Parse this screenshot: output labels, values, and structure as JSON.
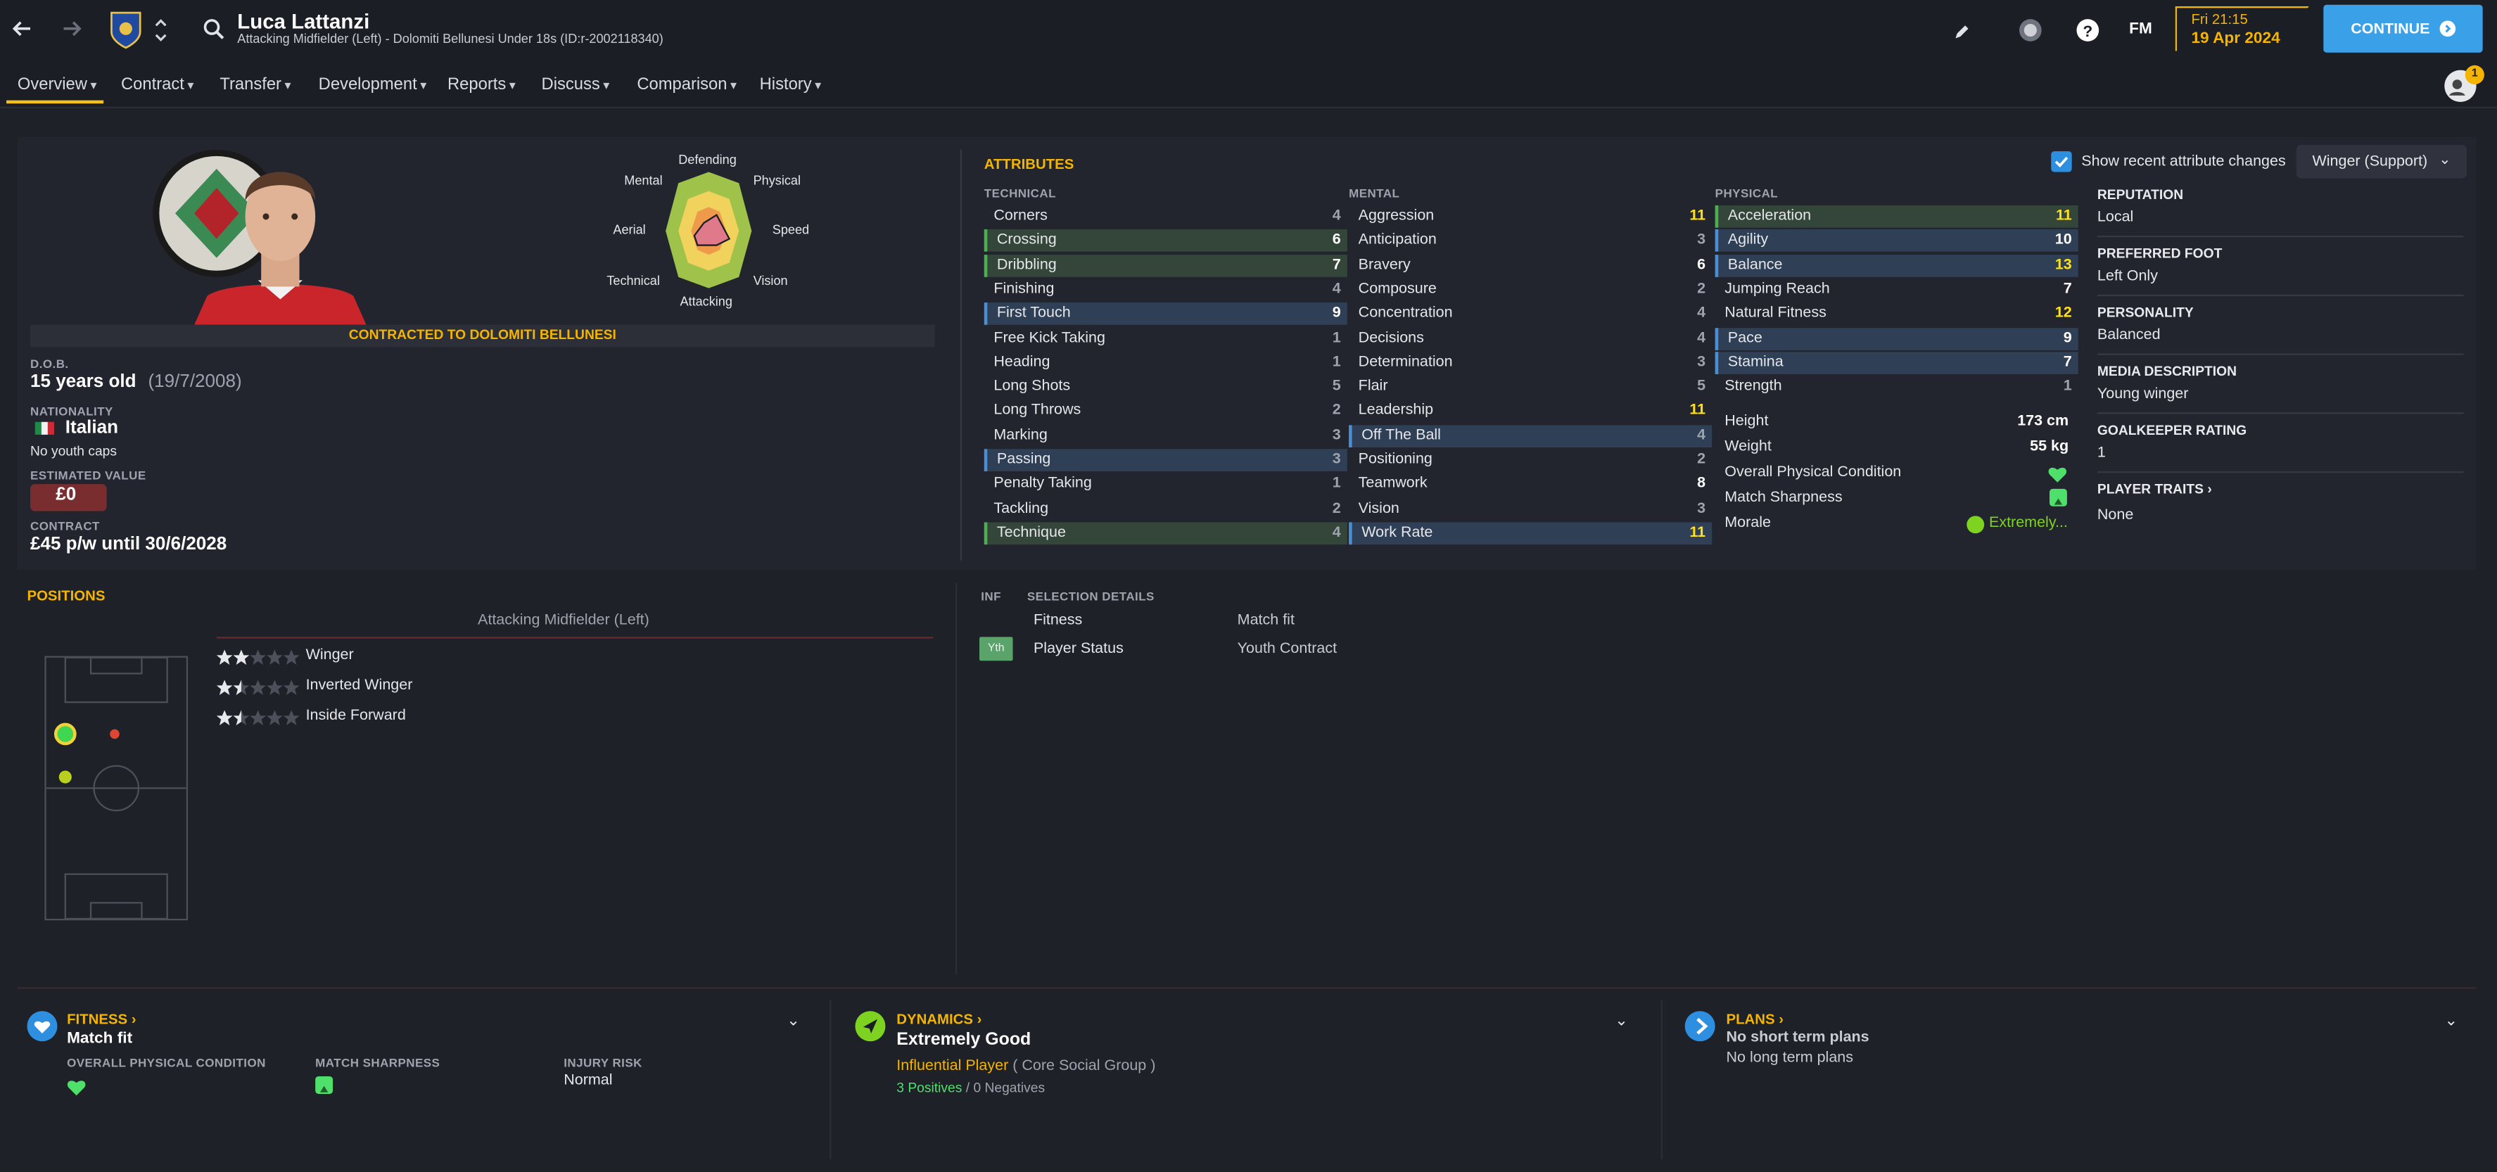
{
  "header": {
    "player_name": "Luca Lattanzi",
    "subtitle": "Attacking Midfielder (Left) - Dolomiti Bellunesi Under 18s (ID:r-2002118340)",
    "day_time": "Fri 21:15",
    "date": "19 Apr 2024",
    "fm_label": "FM",
    "continue_label": "CONTINUE",
    "notification_count": "1"
  },
  "nav": {
    "tabs": [
      "Overview",
      "Contract",
      "Transfer",
      "Development",
      "Reports",
      "Discuss",
      "Comparison",
      "History"
    ]
  },
  "profile": {
    "contract_banner": "CONTRACTED TO DOLOMITI BELLUNESI",
    "dob_label": "D.O.B.",
    "age": "15 years old",
    "dob": "(19/7/2008)",
    "nationality_label": "NATIONALITY",
    "nationality": "Italian",
    "caps": "No youth caps",
    "value_label": "ESTIMATED VALUE",
    "value": "£0",
    "contract_label": "CONTRACT",
    "contract": "£45 p/w until 30/6/2028"
  },
  "radar": {
    "labels": [
      "Defending",
      "Physical",
      "Speed",
      "Vision",
      "Attacking",
      "Technical",
      "Aerial",
      "Mental"
    ]
  },
  "attributes": {
    "title": "ATTRIBUTES",
    "show_changes_label": "Show recent attribute changes",
    "role_select": "Winger (Support)",
    "technical_header": "TECHNICAL",
    "mental_header": "MENTAL",
    "physical_header": "PHYSICAL",
    "technical": [
      {
        "name": "Corners",
        "value": "4"
      },
      {
        "name": "Crossing",
        "value": "6"
      },
      {
        "name": "Dribbling",
        "value": "7"
      },
      {
        "name": "Finishing",
        "value": "4"
      },
      {
        "name": "First Touch",
        "value": "9"
      },
      {
        "name": "Free Kick Taking",
        "value": "1"
      },
      {
        "name": "Heading",
        "value": "1"
      },
      {
        "name": "Long Shots",
        "value": "5"
      },
      {
        "name": "Long Throws",
        "value": "2"
      },
      {
        "name": "Marking",
        "value": "3"
      },
      {
        "name": "Passing",
        "value": "3"
      },
      {
        "name": "Penalty Taking",
        "value": "1"
      },
      {
        "name": "Tackling",
        "value": "2"
      },
      {
        "name": "Technique",
        "value": "4"
      }
    ],
    "mental": [
      {
        "name": "Aggression",
        "value": "11"
      },
      {
        "name": "Anticipation",
        "value": "3"
      },
      {
        "name": "Bravery",
        "value": "6"
      },
      {
        "name": "Composure",
        "value": "2"
      },
      {
        "name": "Concentration",
        "value": "4"
      },
      {
        "name": "Decisions",
        "value": "4"
      },
      {
        "name": "Determination",
        "value": "3"
      },
      {
        "name": "Flair",
        "value": "5"
      },
      {
        "name": "Leadership",
        "value": "11"
      },
      {
        "name": "Off The Ball",
        "value": "4"
      },
      {
        "name": "Positioning",
        "value": "2"
      },
      {
        "name": "Teamwork",
        "value": "8"
      },
      {
        "name": "Vision",
        "value": "3"
      },
      {
        "name": "Work Rate",
        "value": "11"
      }
    ],
    "physical": [
      {
        "name": "Acceleration",
        "value": "11"
      },
      {
        "name": "Agility",
        "value": "10"
      },
      {
        "name": "Balance",
        "value": "13"
      },
      {
        "name": "Jumping Reach",
        "value": "7"
      },
      {
        "name": "Natural Fitness",
        "value": "12"
      },
      {
        "name": "Pace",
        "value": "9"
      },
      {
        "name": "Stamina",
        "value": "7"
      },
      {
        "name": "Strength",
        "value": "1"
      }
    ],
    "height_label": "Height",
    "height": "173 cm",
    "weight_label": "Weight",
    "weight": "55 kg",
    "opc_label": "Overall Physical Condition",
    "sharpness_label": "Match Sharpness",
    "morale_label": "Morale",
    "morale": "Extremely..."
  },
  "side_info": {
    "reputation_label": "REPUTATION",
    "reputation": "Local",
    "foot_label": "PREFERRED FOOT",
    "foot": "Left Only",
    "personality_label": "PERSONALITY",
    "personality": "Balanced",
    "media_label": "MEDIA DESCRIPTION",
    "media": "Young winger",
    "gk_label": "GOALKEEPER RATING",
    "gk": "1",
    "traits_label": "PLAYER TRAITS",
    "traits": "None"
  },
  "positions": {
    "title": "POSITIONS",
    "main_position": "Attacking Midfielder (Left)",
    "roles": [
      {
        "name": "Winger",
        "stars": 2
      },
      {
        "name": "Inverted Winger",
        "stars": 1.5
      },
      {
        "name": "Inside Forward",
        "stars": 1.5
      }
    ]
  },
  "selection": {
    "inf_label": "INF",
    "details_label": "SELECTION DETAILS",
    "fitness_label": "Fitness",
    "fitness_value": "Match fit",
    "status_badge": "Yth",
    "status_label": "Player Status",
    "status_value": "Youth Contract"
  },
  "cards": {
    "fitness_title": "FITNESS",
    "fitness_sub": "Match fit",
    "opc_label": "OVERALL PHYSICAL CONDITION",
    "sharpness_label": "MATCH SHARPNESS",
    "injury_label": "INJURY RISK",
    "injury_value": "Normal",
    "dynamics_title": "DYNAMICS",
    "dynamics_sub": "Extremely Good",
    "influence": "Influential Player",
    "group": "( Core Social Group )",
    "positives": "3 Positives",
    "separator": "/",
    "negatives": "0 Negatives",
    "plans_title": "PLANS",
    "short_plans": "No short term plans",
    "long_plans": "No long term plans"
  },
  "colors": {
    "accent": "#f4b400",
    "continue": "#3aa0e8",
    "highlight_green": "#34453a",
    "highlight_blue": "#2f3f55"
  }
}
